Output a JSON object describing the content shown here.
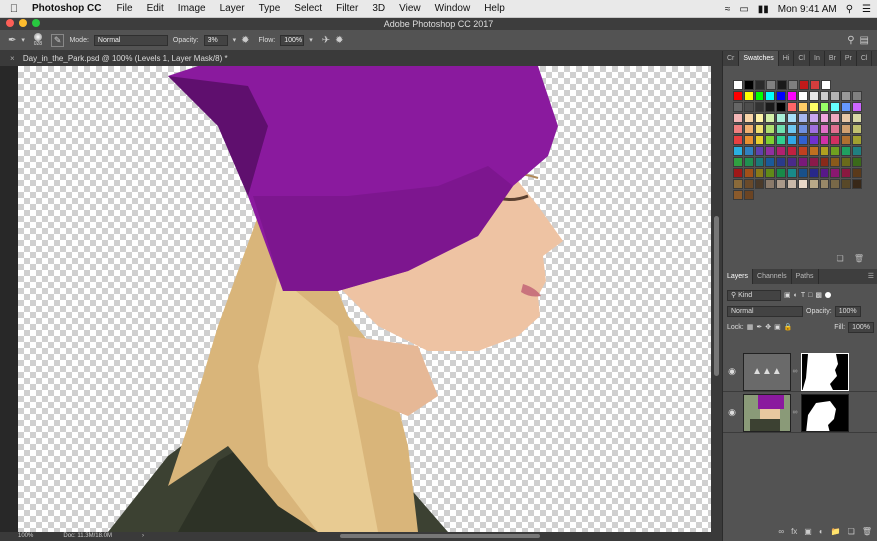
{
  "menubar": {
    "app": "Photoshop CC",
    "items": [
      "File",
      "Edit",
      "Image",
      "Layer",
      "Type",
      "Select",
      "Filter",
      "3D",
      "View",
      "Window",
      "Help"
    ],
    "clock": "Mon 9:41 AM"
  },
  "window": {
    "title": "Adobe Photoshop CC 2017"
  },
  "options": {
    "brush_size": "028",
    "mode_label": "Mode:",
    "mode_value": "Normal",
    "opacity_label": "Opacity:",
    "opacity_value": "3%",
    "flow_label": "Flow:",
    "flow_value": "100%"
  },
  "document": {
    "tab_title": "Day_in_the_Park.psd @ 100% (Levels 1, Layer Mask/8) *"
  },
  "status": {
    "zoom": "100%",
    "doc": "Doc: 11.3M/18.0M"
  },
  "swatches_panel": {
    "tabs": [
      "Cr",
      "Swatches",
      "Hi",
      "Cl",
      "In",
      "Br",
      "Pr",
      "Cl"
    ],
    "rows": [
      [
        "#ffffff",
        "#000000",
        "#2b2b2b",
        "#808080",
        "#1a1a1a",
        "#7f7f7f",
        "#c21a1a",
        "#d43d3d",
        "#ffffff"
      ],
      [
        "#ff0000",
        "#ffff00",
        "#00ff00",
        "#00ffff",
        "#0000ff",
        "#ff00ff",
        "#ffffff",
        "#e6e6e6",
        "#cccccc",
        "#b3b3b3",
        "#999999",
        "#808080"
      ],
      [
        "#666666",
        "#4d4d4d",
        "#333333",
        "#1a1a1a",
        "#000000",
        "#ff6666",
        "#ffcc66",
        "#ffff66",
        "#99ff66",
        "#66ffff",
        "#6699ff",
        "#cc66ff"
      ],
      [
        "#f4b6b6",
        "#f8d4a8",
        "#fff3a8",
        "#d4f0a8",
        "#a8f0d8",
        "#a8e0f8",
        "#a8b8f0",
        "#c8a8f0",
        "#f0a8e0",
        "#f0a8c0",
        "#e8c8a8",
        "#d8d8a8"
      ],
      [
        "#f08080",
        "#f0b070",
        "#f0e070",
        "#b0e070",
        "#70e0b0",
        "#70c8f0",
        "#7090e0",
        "#a070e0",
        "#e070c8",
        "#e07090",
        "#d0a070",
        "#c0c070"
      ],
      [
        "#e84040",
        "#e89030",
        "#e8d030",
        "#80d030",
        "#30d090",
        "#30a8e8",
        "#3060d0",
        "#7030d0",
        "#d030a8",
        "#d03060",
        "#b07030",
        "#a0a030"
      ],
      [
        "#2ab0e0",
        "#3080c0",
        "#6040b0",
        "#9030a0",
        "#b02070",
        "#c02040",
        "#c04020",
        "#c07020",
        "#b0a020",
        "#70a020",
        "#20a060",
        "#208080"
      ],
      [
        "#30a040",
        "#209050",
        "#1a7a7a",
        "#1a5a9a",
        "#2a3a8a",
        "#4a2a8a",
        "#7a1a7a",
        "#8a1a4a",
        "#8a2a1a",
        "#8a5a1a",
        "#6a6a1a",
        "#3a6a1a"
      ],
      [
        "#a01818",
        "#a05018",
        "#8a7a18",
        "#608a18",
        "#188a48",
        "#188a8a",
        "#18508a",
        "#28288a",
        "#58188a",
        "#8a1870",
        "#8a1840",
        "#5a3a1a"
      ],
      [
        "#8a6a3a",
        "#6a4a2a",
        "#4a3a2a",
        "#8a7a6a",
        "#aa9a8a",
        "#c8b8a8",
        "#e8d8c8",
        "#b8a888",
        "#988868",
        "#786848",
        "#584828",
        "#382818"
      ],
      [
        "#8b5a2b",
        "#6b4423"
      ]
    ]
  },
  "layers_panel": {
    "tabs": [
      "Layers",
      "Channels",
      "Paths"
    ],
    "kind_label": "Kind",
    "blend_mode": "Normal",
    "opacity_label": "Opacity:",
    "opacity_value": "100%",
    "lock_label": "Lock:",
    "fill_label": "Fill:",
    "fill_value": "100%"
  }
}
